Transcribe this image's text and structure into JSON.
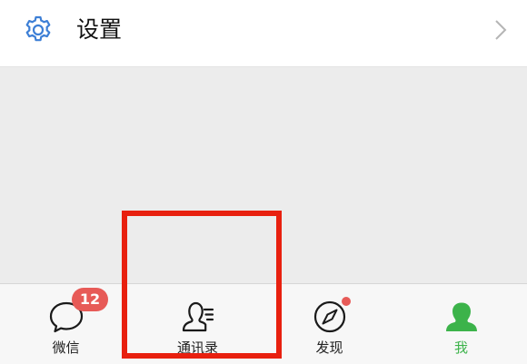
{
  "settings": {
    "icon": "gear-icon",
    "label": "设置",
    "chevron": "chevron-right-icon",
    "icon_color": "#3d7fd6"
  },
  "tabbar": {
    "tabs": [
      {
        "label": "微信",
        "icon": "chat-bubble-icon",
        "badge": "12"
      },
      {
        "label": "通讯录",
        "icon": "contacts-icon"
      },
      {
        "label": "发现",
        "icon": "compass-icon",
        "has_dot": true
      },
      {
        "label": "我",
        "icon": "person-icon",
        "active": true
      }
    ],
    "active_color": "#3cb34a",
    "badge_color": "#e75a57"
  },
  "annotation": {
    "type": "highlight-rectangle",
    "target": "通讯录",
    "color": "#e8200f"
  }
}
